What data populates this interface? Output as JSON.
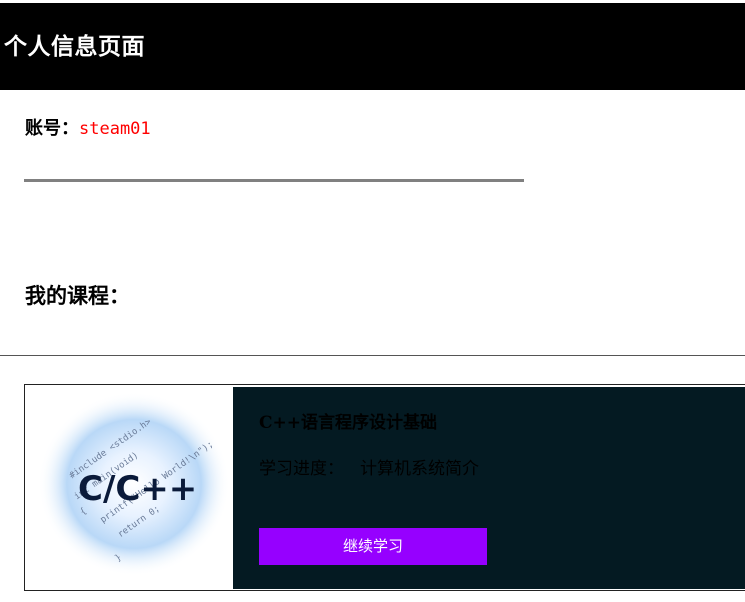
{
  "header": {
    "title": "个人信息页面"
  },
  "account": {
    "label": "账号：",
    "value": "steam01"
  },
  "courses": {
    "heading": "我的课程：",
    "items": [
      {
        "title": "C++语言程序设计基础",
        "progress_label": "学习进度：",
        "progress_value": "计算机系统简介",
        "button_label": "继续学习",
        "thumbnail": {
          "logo_text": "C/C++",
          "code_lines": [
            "#include <stdio.h>",
            "int main(void)",
            "{",
            "printf(\"Hello World!\\n\");",
            "return 0;",
            "}"
          ]
        }
      }
    ]
  },
  "colors": {
    "header_bg": "#000000",
    "account_value": "#ff0000",
    "card_bg": "#041a22",
    "button_bg": "#9600ff"
  }
}
